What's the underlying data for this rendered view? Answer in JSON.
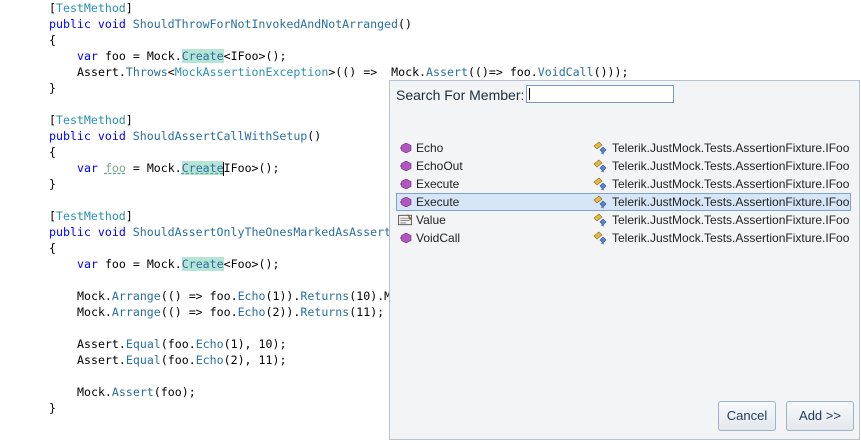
{
  "editor": {
    "keywords": {
      "public": "public",
      "void": "void",
      "var": "var"
    },
    "attribute": "TestMethod",
    "method1": "ShouldThrowForNotInvokedAndNotArranged",
    "method2": "ShouldAssertCallWithSetup",
    "method3": "ShouldAssertOnlyTheOnesMarkedAsAssert",
    "brace_open": "{",
    "brace_close": "}",
    "var_name": "foo",
    "eq_mock": " = Mock.",
    "create": "Create",
    "ifoo_generic": "<IFoo>();",
    "foo_generic": "<Foo>();",
    "ifoo_caret_suffix": "IFoo>();",
    "assert_prefix": "Assert.",
    "throws": "Throws",
    "exception_type": "MockAssertionException",
    "throws_tail": ">(() =>  Mock.",
    "assert_word": "Assert",
    "assert_tail": "(()=> foo.",
    "voidcall": "VoidCall",
    "voidcall_tail": "()));",
    "mock_dot": "Mock.",
    "arrange": "Arrange",
    "arrange1_mid": "(() => foo.",
    "echo": "Echo",
    "arrange1_args": "(1)).",
    "returns": "Returns",
    "arrange1_tail": "(10).M",
    "arrange2_args": "(2)).",
    "arrange2_tail": "(11);",
    "equal": "Equal",
    "equal1_tail": "(foo.",
    "equal1_args": "(1), 10);",
    "equal2_args": "(2), 11);",
    "final_assert_tail": "(foo);"
  },
  "popup": {
    "search_label": "Search For Member:",
    "search_value": "",
    "items": [
      {
        "name": "Echo",
        "type": "Telerik.JustMock.Tests.AssertionFixture.IFoo",
        "kind": "method-icon"
      },
      {
        "name": "EchoOut",
        "type": "Telerik.JustMock.Tests.AssertionFixture.IFoo",
        "kind": "method-icon"
      },
      {
        "name": "Execute",
        "type": "Telerik.JustMock.Tests.AssertionFixture.IFoo",
        "kind": "method-icon"
      },
      {
        "name": "Execute",
        "type": "Telerik.JustMock.Tests.AssertionFixture.IFoo",
        "kind": "method-icon",
        "selected": true
      },
      {
        "name": "Value",
        "type": "Telerik.JustMock.Tests.AssertionFixture.IFoo",
        "kind": "property-icon"
      },
      {
        "name": "VoidCall",
        "type": "Telerik.JustMock.Tests.AssertionFixture.IFoo",
        "kind": "method-icon"
      }
    ],
    "cancel_label": "Cancel",
    "add_label": "Add >>"
  },
  "colors": {
    "keyword": "#0000ff",
    "type": "#2b91af",
    "highlight": "#b7e4d4",
    "selection": "#d6e6f6"
  }
}
